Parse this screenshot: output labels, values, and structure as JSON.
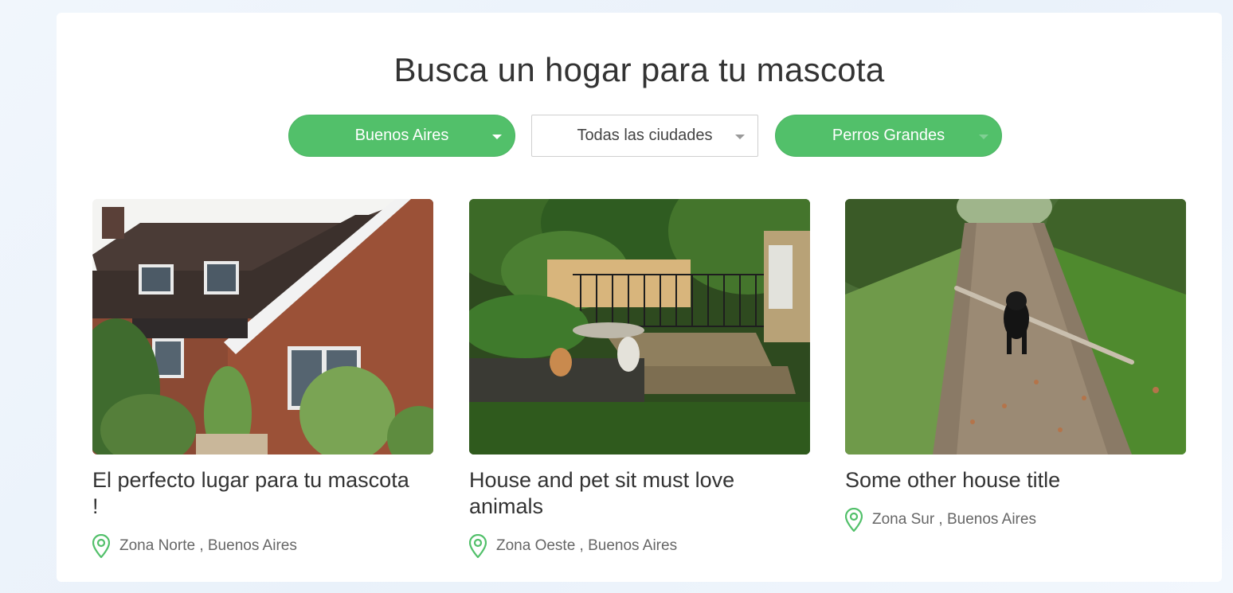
{
  "header": {
    "title": "Busca un hogar para tu mascota"
  },
  "filters": {
    "province": "Buenos Aires",
    "city": "Todas las ciudades",
    "pet_type": "Perros Grandes"
  },
  "colors": {
    "accent": "#52c06a",
    "text": "#333333",
    "muted": "#666666"
  },
  "listings": [
    {
      "title": "El perfecto lugar para tu mascota !",
      "location": "Zona Norte , Buenos Aires",
      "photo": "brick-house-photo"
    },
    {
      "title": "House and pet sit must love animals",
      "location": "Zona Oeste , Buenos Aires",
      "photo": "garden-pool-photo"
    },
    {
      "title": "Some other house title",
      "location": "Zona Sur , Buenos Aires",
      "photo": "dog-with-stick-photo"
    }
  ],
  "icons": {
    "location": "map-pin-icon",
    "dropdown": "chevron-down-icon"
  }
}
